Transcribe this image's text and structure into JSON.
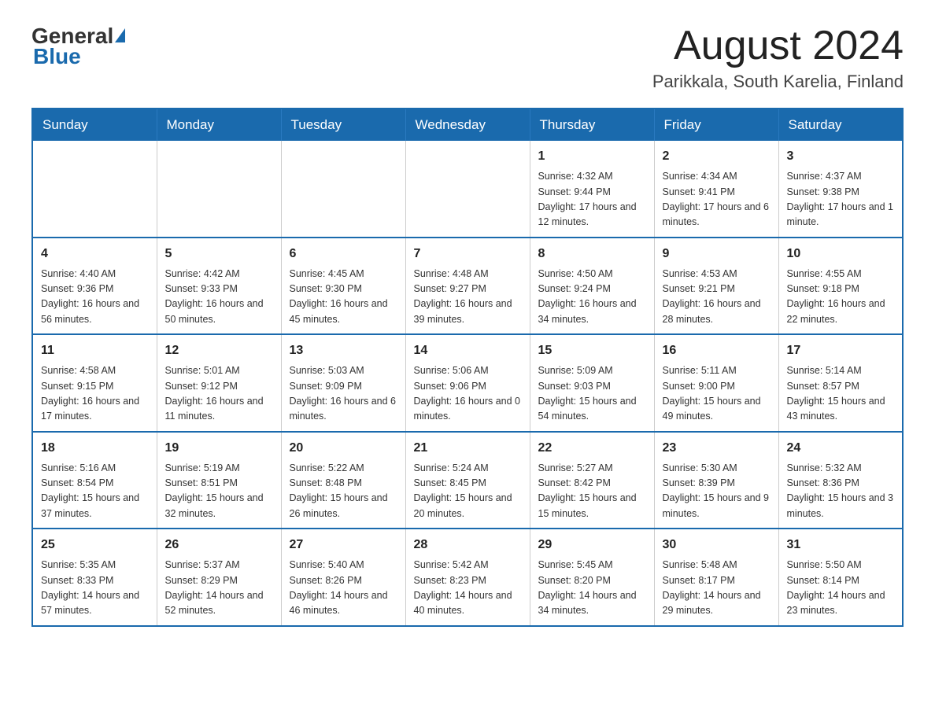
{
  "header": {
    "logo_general": "General",
    "logo_blue": "Blue",
    "title": "August 2024",
    "subtitle": "Parikkala, South Karelia, Finland"
  },
  "calendar": {
    "days_of_week": [
      "Sunday",
      "Monday",
      "Tuesday",
      "Wednesday",
      "Thursday",
      "Friday",
      "Saturday"
    ],
    "weeks": [
      [
        {
          "day": "",
          "info": ""
        },
        {
          "day": "",
          "info": ""
        },
        {
          "day": "",
          "info": ""
        },
        {
          "day": "",
          "info": ""
        },
        {
          "day": "1",
          "info": "Sunrise: 4:32 AM\nSunset: 9:44 PM\nDaylight: 17 hours and 12 minutes."
        },
        {
          "day": "2",
          "info": "Sunrise: 4:34 AM\nSunset: 9:41 PM\nDaylight: 17 hours and 6 minutes."
        },
        {
          "day": "3",
          "info": "Sunrise: 4:37 AM\nSunset: 9:38 PM\nDaylight: 17 hours and 1 minute."
        }
      ],
      [
        {
          "day": "4",
          "info": "Sunrise: 4:40 AM\nSunset: 9:36 PM\nDaylight: 16 hours and 56 minutes."
        },
        {
          "day": "5",
          "info": "Sunrise: 4:42 AM\nSunset: 9:33 PM\nDaylight: 16 hours and 50 minutes."
        },
        {
          "day": "6",
          "info": "Sunrise: 4:45 AM\nSunset: 9:30 PM\nDaylight: 16 hours and 45 minutes."
        },
        {
          "day": "7",
          "info": "Sunrise: 4:48 AM\nSunset: 9:27 PM\nDaylight: 16 hours and 39 minutes."
        },
        {
          "day": "8",
          "info": "Sunrise: 4:50 AM\nSunset: 9:24 PM\nDaylight: 16 hours and 34 minutes."
        },
        {
          "day": "9",
          "info": "Sunrise: 4:53 AM\nSunset: 9:21 PM\nDaylight: 16 hours and 28 minutes."
        },
        {
          "day": "10",
          "info": "Sunrise: 4:55 AM\nSunset: 9:18 PM\nDaylight: 16 hours and 22 minutes."
        }
      ],
      [
        {
          "day": "11",
          "info": "Sunrise: 4:58 AM\nSunset: 9:15 PM\nDaylight: 16 hours and 17 minutes."
        },
        {
          "day": "12",
          "info": "Sunrise: 5:01 AM\nSunset: 9:12 PM\nDaylight: 16 hours and 11 minutes."
        },
        {
          "day": "13",
          "info": "Sunrise: 5:03 AM\nSunset: 9:09 PM\nDaylight: 16 hours and 6 minutes."
        },
        {
          "day": "14",
          "info": "Sunrise: 5:06 AM\nSunset: 9:06 PM\nDaylight: 16 hours and 0 minutes."
        },
        {
          "day": "15",
          "info": "Sunrise: 5:09 AM\nSunset: 9:03 PM\nDaylight: 15 hours and 54 minutes."
        },
        {
          "day": "16",
          "info": "Sunrise: 5:11 AM\nSunset: 9:00 PM\nDaylight: 15 hours and 49 minutes."
        },
        {
          "day": "17",
          "info": "Sunrise: 5:14 AM\nSunset: 8:57 PM\nDaylight: 15 hours and 43 minutes."
        }
      ],
      [
        {
          "day": "18",
          "info": "Sunrise: 5:16 AM\nSunset: 8:54 PM\nDaylight: 15 hours and 37 minutes."
        },
        {
          "day": "19",
          "info": "Sunrise: 5:19 AM\nSunset: 8:51 PM\nDaylight: 15 hours and 32 minutes."
        },
        {
          "day": "20",
          "info": "Sunrise: 5:22 AM\nSunset: 8:48 PM\nDaylight: 15 hours and 26 minutes."
        },
        {
          "day": "21",
          "info": "Sunrise: 5:24 AM\nSunset: 8:45 PM\nDaylight: 15 hours and 20 minutes."
        },
        {
          "day": "22",
          "info": "Sunrise: 5:27 AM\nSunset: 8:42 PM\nDaylight: 15 hours and 15 minutes."
        },
        {
          "day": "23",
          "info": "Sunrise: 5:30 AM\nSunset: 8:39 PM\nDaylight: 15 hours and 9 minutes."
        },
        {
          "day": "24",
          "info": "Sunrise: 5:32 AM\nSunset: 8:36 PM\nDaylight: 15 hours and 3 minutes."
        }
      ],
      [
        {
          "day": "25",
          "info": "Sunrise: 5:35 AM\nSunset: 8:33 PM\nDaylight: 14 hours and 57 minutes."
        },
        {
          "day": "26",
          "info": "Sunrise: 5:37 AM\nSunset: 8:29 PM\nDaylight: 14 hours and 52 minutes."
        },
        {
          "day": "27",
          "info": "Sunrise: 5:40 AM\nSunset: 8:26 PM\nDaylight: 14 hours and 46 minutes."
        },
        {
          "day": "28",
          "info": "Sunrise: 5:42 AM\nSunset: 8:23 PM\nDaylight: 14 hours and 40 minutes."
        },
        {
          "day": "29",
          "info": "Sunrise: 5:45 AM\nSunset: 8:20 PM\nDaylight: 14 hours and 34 minutes."
        },
        {
          "day": "30",
          "info": "Sunrise: 5:48 AM\nSunset: 8:17 PM\nDaylight: 14 hours and 29 minutes."
        },
        {
          "day": "31",
          "info": "Sunrise: 5:50 AM\nSunset: 8:14 PM\nDaylight: 14 hours and 23 minutes."
        }
      ]
    ]
  }
}
